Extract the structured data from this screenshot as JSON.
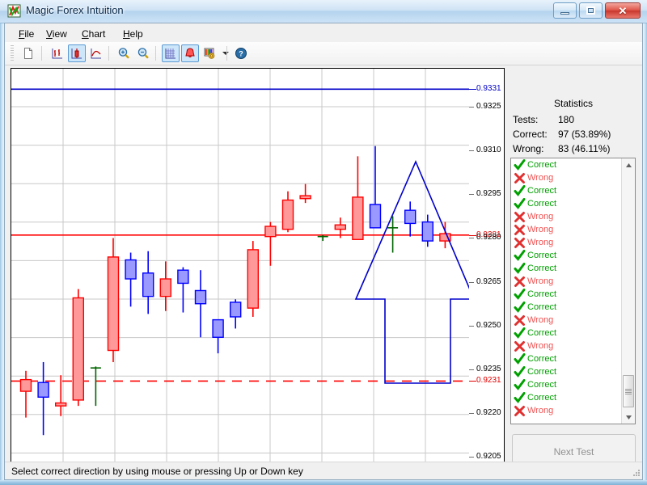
{
  "window": {
    "title": "Magic Forex Intuition",
    "app_icon": "chart-logo-icon",
    "buttons": {
      "minimize": "minimize-icon",
      "maximize": "maximize-icon",
      "close": "close-icon"
    }
  },
  "menubar": {
    "items": [
      {
        "label": "File",
        "accel": "F"
      },
      {
        "label": "View",
        "accel": "V"
      },
      {
        "label": "Chart",
        "accel": "C"
      },
      {
        "label": "Help",
        "accel": "H"
      }
    ]
  },
  "toolbar": {
    "items": [
      {
        "name": "new-test-icon",
        "active": false
      },
      {
        "name": "bar-chart-icon",
        "active": false
      },
      {
        "name": "candlestick-icon",
        "active": true
      },
      {
        "name": "line-chart-icon",
        "active": false
      },
      {
        "name": "zoom-in-icon",
        "active": false
      },
      {
        "name": "zoom-out-icon",
        "active": false
      },
      {
        "name": "grid-icon",
        "active": true
      },
      {
        "name": "alert-bell-icon",
        "active": true
      },
      {
        "name": "color-settings-icon",
        "active": false
      },
      {
        "name": "dropdown-arrow-icon",
        "active": false
      },
      {
        "name": "help-icon",
        "active": false
      }
    ]
  },
  "statistics": {
    "title": "Statistics",
    "tests_label": "Tests:",
    "tests_value": "180",
    "correct_label": "Correct:",
    "correct_value": "97 (53.89%)",
    "wrong_label": "Wrong:",
    "wrong_value": "83 (46.11%)"
  },
  "results": {
    "correct_label": "Correct",
    "wrong_label": "Wrong",
    "items": [
      "Correct",
      "Wrong",
      "Correct",
      "Correct",
      "Wrong",
      "Wrong",
      "Wrong",
      "Correct",
      "Correct",
      "Wrong",
      "Correct",
      "Correct",
      "Wrong",
      "Correct",
      "Wrong",
      "Correct",
      "Correct",
      "Correct",
      "Correct",
      "Wrong"
    ]
  },
  "next_test_button": {
    "label": "Next Test",
    "enabled": false
  },
  "statusbar": {
    "text": "Select correct direction by using mouse or pressing Up or Down key"
  },
  "colors": {
    "bull_body": "#9999ff",
    "bull_outline": "#0000ff",
    "bear_body": "#ff9999",
    "bear_outline": "#ff0000",
    "doji": "#006400",
    "grid": "#c8c8c8",
    "price_line_red": "#ff0000",
    "price_line_blue": "#0000c8",
    "arrow": "#0000cc",
    "correct": "#00a000",
    "wrong": "#f05050"
  },
  "chart_data": {
    "type": "candlestick",
    "title": "",
    "xlabel": "",
    "ylabel": "",
    "ylim": [
      0.9199,
      0.9338
    ],
    "grid": true,
    "y_ticks": [
      {
        "value": 0.9331,
        "label": "0.9331",
        "highlight": "blue"
      },
      {
        "value": 0.9325,
        "label": "0.9325",
        "highlight": "none"
      },
      {
        "value": 0.931,
        "label": "0.9310",
        "highlight": "none"
      },
      {
        "value": 0.9295,
        "label": "0.9295",
        "highlight": "none"
      },
      {
        "value": 0.9281,
        "label": "0.9281",
        "highlight": "red"
      },
      {
        "value": 0.928,
        "label": "0.9280",
        "highlight": "none"
      },
      {
        "value": 0.9265,
        "label": "0.9265",
        "highlight": "none"
      },
      {
        "value": 0.925,
        "label": "0.9250",
        "highlight": "none"
      },
      {
        "value": 0.9235,
        "label": "0.9235",
        "highlight": "none"
      },
      {
        "value": 0.9231,
        "label": "0.9231",
        "highlight": "red"
      },
      {
        "value": 0.922,
        "label": "0.9220",
        "highlight": "none"
      },
      {
        "value": 0.9205,
        "label": "0.9205",
        "highlight": "none"
      }
    ],
    "reference_lines": [
      {
        "value": 0.9331,
        "color": "#0000c8",
        "style": "solid"
      },
      {
        "value": 0.9281,
        "color": "#ff0000",
        "style": "solid"
      },
      {
        "value": 0.9231,
        "color": "#ff0000",
        "style": "dashed"
      }
    ],
    "candles": [
      {
        "i": 0,
        "o": 0.92315,
        "h": 0.92345,
        "l": 0.92185,
        "c": 0.92275,
        "dir": "down"
      },
      {
        "i": 1,
        "o": 0.92255,
        "h": 0.92375,
        "l": 0.92125,
        "c": 0.92305,
        "dir": "up"
      },
      {
        "i": 2,
        "o": 0.92235,
        "h": 0.9233,
        "l": 0.9219,
        "c": 0.92225,
        "dir": "down"
      },
      {
        "i": 3,
        "o": 0.92595,
        "h": 0.92625,
        "l": 0.92225,
        "c": 0.92245,
        "dir": "down"
      },
      {
        "i": 4,
        "o": 0.92355,
        "h": 0.9236,
        "l": 0.92225,
        "c": 0.92355,
        "dir": "doji"
      },
      {
        "i": 5,
        "o": 0.92735,
        "h": 0.928,
        "l": 0.92375,
        "c": 0.92415,
        "dir": "down"
      },
      {
        "i": 6,
        "o": 0.9266,
        "h": 0.9275,
        "l": 0.92565,
        "c": 0.92725,
        "dir": "up"
      },
      {
        "i": 7,
        "o": 0.926,
        "h": 0.92755,
        "l": 0.9254,
        "c": 0.9268,
        "dir": "up"
      },
      {
        "i": 8,
        "o": 0.9266,
        "h": 0.9272,
        "l": 0.9255,
        "c": 0.926,
        "dir": "down"
      },
      {
        "i": 9,
        "o": 0.92645,
        "h": 0.927,
        "l": 0.92545,
        "c": 0.9269,
        "dir": "up"
      },
      {
        "i": 10,
        "o": 0.92575,
        "h": 0.9269,
        "l": 0.9246,
        "c": 0.9262,
        "dir": "up"
      },
      {
        "i": 11,
        "o": 0.9246,
        "h": 0.9251,
        "l": 0.92405,
        "c": 0.9252,
        "dir": "up"
      },
      {
        "i": 12,
        "o": 0.9253,
        "h": 0.9259,
        "l": 0.9249,
        "c": 0.9258,
        "dir": "up"
      },
      {
        "i": 13,
        "o": 0.9276,
        "h": 0.9279,
        "l": 0.9253,
        "c": 0.9256,
        "dir": "down"
      },
      {
        "i": 14,
        "o": 0.9284,
        "h": 0.92855,
        "l": 0.92705,
        "c": 0.92805,
        "dir": "down"
      },
      {
        "i": 15,
        "o": 0.9293,
        "h": 0.9296,
        "l": 0.9282,
        "c": 0.9283,
        "dir": "down"
      },
      {
        "i": 16,
        "o": 0.92935,
        "h": 0.92985,
        "l": 0.9292,
        "c": 0.92945,
        "dir": "down"
      },
      {
        "i": 17,
        "o": 0.9281,
        "h": 0.9281,
        "l": 0.9279,
        "c": 0.92805,
        "dir": "doji"
      },
      {
        "i": 18,
        "o": 0.9283,
        "h": 0.9287,
        "l": 0.928,
        "c": 0.92845,
        "dir": "down"
      },
      {
        "i": 19,
        "o": 0.9294,
        "h": 0.9308,
        "l": 0.928,
        "c": 0.92795,
        "dir": "down"
      },
      {
        "i": 20,
        "o": 0.92915,
        "h": 0.93115,
        "l": 0.9286,
        "c": 0.92835,
        "dir": "up"
      },
      {
        "i": 21,
        "o": 0.92845,
        "h": 0.92875,
        "l": 0.9275,
        "c": 0.92835,
        "dir": "doji"
      },
      {
        "i": 22,
        "o": 0.92895,
        "h": 0.92925,
        "l": 0.92805,
        "c": 0.9285,
        "dir": "up"
      },
      {
        "i": 23,
        "o": 0.92855,
        "h": 0.9288,
        "l": 0.9277,
        "c": 0.9279,
        "dir": "up"
      },
      {
        "i": 24,
        "o": 0.92815,
        "h": 0.92855,
        "l": 0.92765,
        "c": 0.9279,
        "dir": "down"
      }
    ],
    "prediction_arrow": {
      "direction": "up",
      "color": "#0000cc",
      "style": "outline"
    }
  }
}
